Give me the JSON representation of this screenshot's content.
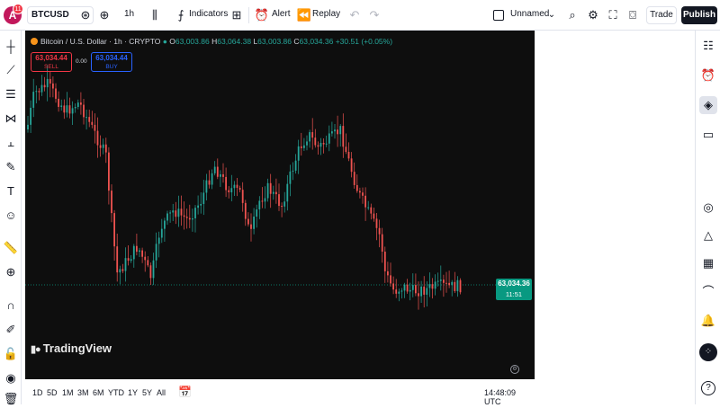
{
  "topbar": {
    "avatar_letter": "A",
    "notif_count": "11",
    "symbol": "BTCUSD",
    "interval": "1h",
    "indicators_label": "Indicators",
    "alert_label": "Alert",
    "replay_label": "Replay",
    "layout_name": "Unnamed",
    "trade_label": "Trade",
    "publish_label": "Publish"
  },
  "chart": {
    "title": "Bitcoin / U.S. Dollar · 1h · CRYPTO",
    "o_label": "O",
    "o_value": "63,003.86",
    "h_label": "H",
    "h_value": "63,064.38",
    "l_label": "L",
    "l_value": "63,003.86",
    "c_label": "C",
    "c_value": "63,034.36",
    "change": "+30.51 (+0.05%)",
    "sell_price": "63,034.44",
    "sell_label": "SELL",
    "buy_price": "63,034.44",
    "buy_label": "BUY",
    "spread": "0.00",
    "last_price": "63,034.36",
    "countdown": "11:51",
    "logo_text": "TradingView",
    "up_color": "#26a69a",
    "down_color": "#ef5350"
  },
  "bottombar": {
    "ranges": [
      "1D",
      "5D",
      "1M",
      "3M",
      "6M",
      "YTD",
      "1Y",
      "5Y",
      "All"
    ],
    "time": "14:48:09 UTC"
  },
  "icons": {
    "left": [
      "crosshair-icon",
      "trendline-icon",
      "fib-icon",
      "pattern-icon",
      "projection-icon",
      "brush-icon",
      "text-icon",
      "emoji-icon",
      "ruler-icon",
      "zoom-icon",
      "magnet-icon",
      "lock-draw-icon",
      "lock-icon",
      "eye-icon",
      "trash-icon"
    ],
    "right": [
      "watchlist-icon",
      "alarm-icon",
      "layers-icon",
      "chat-icon",
      "target-icon",
      "ideas-icon",
      "calendar-icon",
      "broadcast-icon",
      "bell-icon",
      "dots-icon",
      "help-icon"
    ]
  }
}
